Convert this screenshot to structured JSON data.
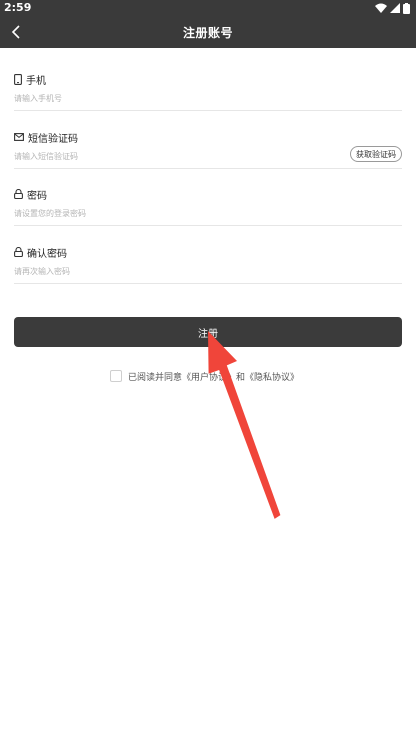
{
  "status_bar": {
    "time": "2:59"
  },
  "nav": {
    "title": "注册账号"
  },
  "form": {
    "phone": {
      "label": "手机",
      "placeholder": "请输入手机号"
    },
    "sms_code": {
      "label": "短信验证码",
      "placeholder": "请输入短信验证码",
      "button": "获取验证码"
    },
    "password": {
      "label": "密码",
      "placeholder": "请设置您的登录密码"
    },
    "confirm_password": {
      "label": "确认密码",
      "placeholder": "请再次输入密码"
    }
  },
  "register_button": "注册",
  "agreement": {
    "prefix": "已阅读并同意",
    "user_agreement": "《用户协议》",
    "and": "和",
    "privacy_policy": "《隐私协议》"
  },
  "colors": {
    "header_bg": "#3a3a3a",
    "button_bg": "#3b3b3b",
    "arrow": "#f0453a"
  }
}
